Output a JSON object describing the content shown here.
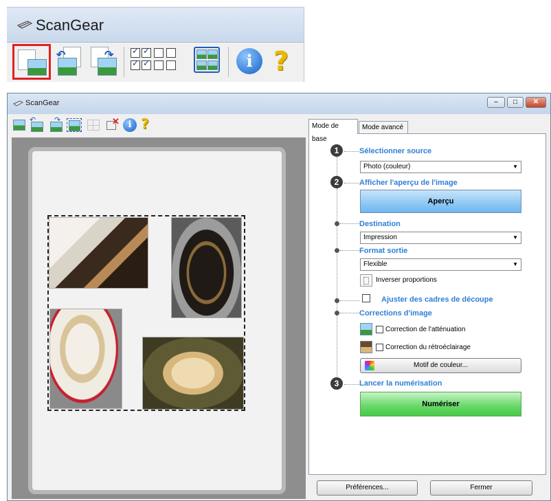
{
  "app": {
    "title": "ScanGear"
  },
  "colors": {
    "accent": "#2f7fd5",
    "preview_button": "#8ec8f4",
    "scan_button": "#66d866",
    "highlight": "#e02020"
  },
  "toolbar_icons": [
    "view-image-icon",
    "rotate-left-icon",
    "rotate-right-icon",
    "auto-crop-icon",
    "select-all-frames-icon",
    "remove-frame-icon",
    "information-icon",
    "help-icon"
  ],
  "tabs": [
    {
      "label": "Mode de base",
      "active": true
    },
    {
      "label": "Mode avancé",
      "active": false
    }
  ],
  "step1": {
    "number": "1",
    "heading": "Sélectionner source",
    "select_value": "Photo (couleur)"
  },
  "step2": {
    "number": "2",
    "heading": "Afficher l'aperçu de l'image",
    "button": "Aperçu"
  },
  "destination": {
    "heading": "Destination",
    "select_value": "Impression"
  },
  "output": {
    "heading": "Format sortie",
    "select_value": "Flexible",
    "invert_label": "Inverser proportions"
  },
  "crop": {
    "label": "Ajuster des cadres de découpe",
    "checked": false
  },
  "corrections": {
    "heading": "Corrections d'image",
    "fading_label": "Correction de l'atténuation",
    "fading_checked": false,
    "backlight_label": "Correction du rétroéclairage",
    "backlight_checked": false,
    "color_pattern_button": "Motif de couleur..."
  },
  "step3": {
    "number": "3",
    "heading": "Lancer la numérisation",
    "button": "Numériser"
  },
  "footer": {
    "preferences_button": "Préférences...",
    "close_button": "Fermer"
  }
}
